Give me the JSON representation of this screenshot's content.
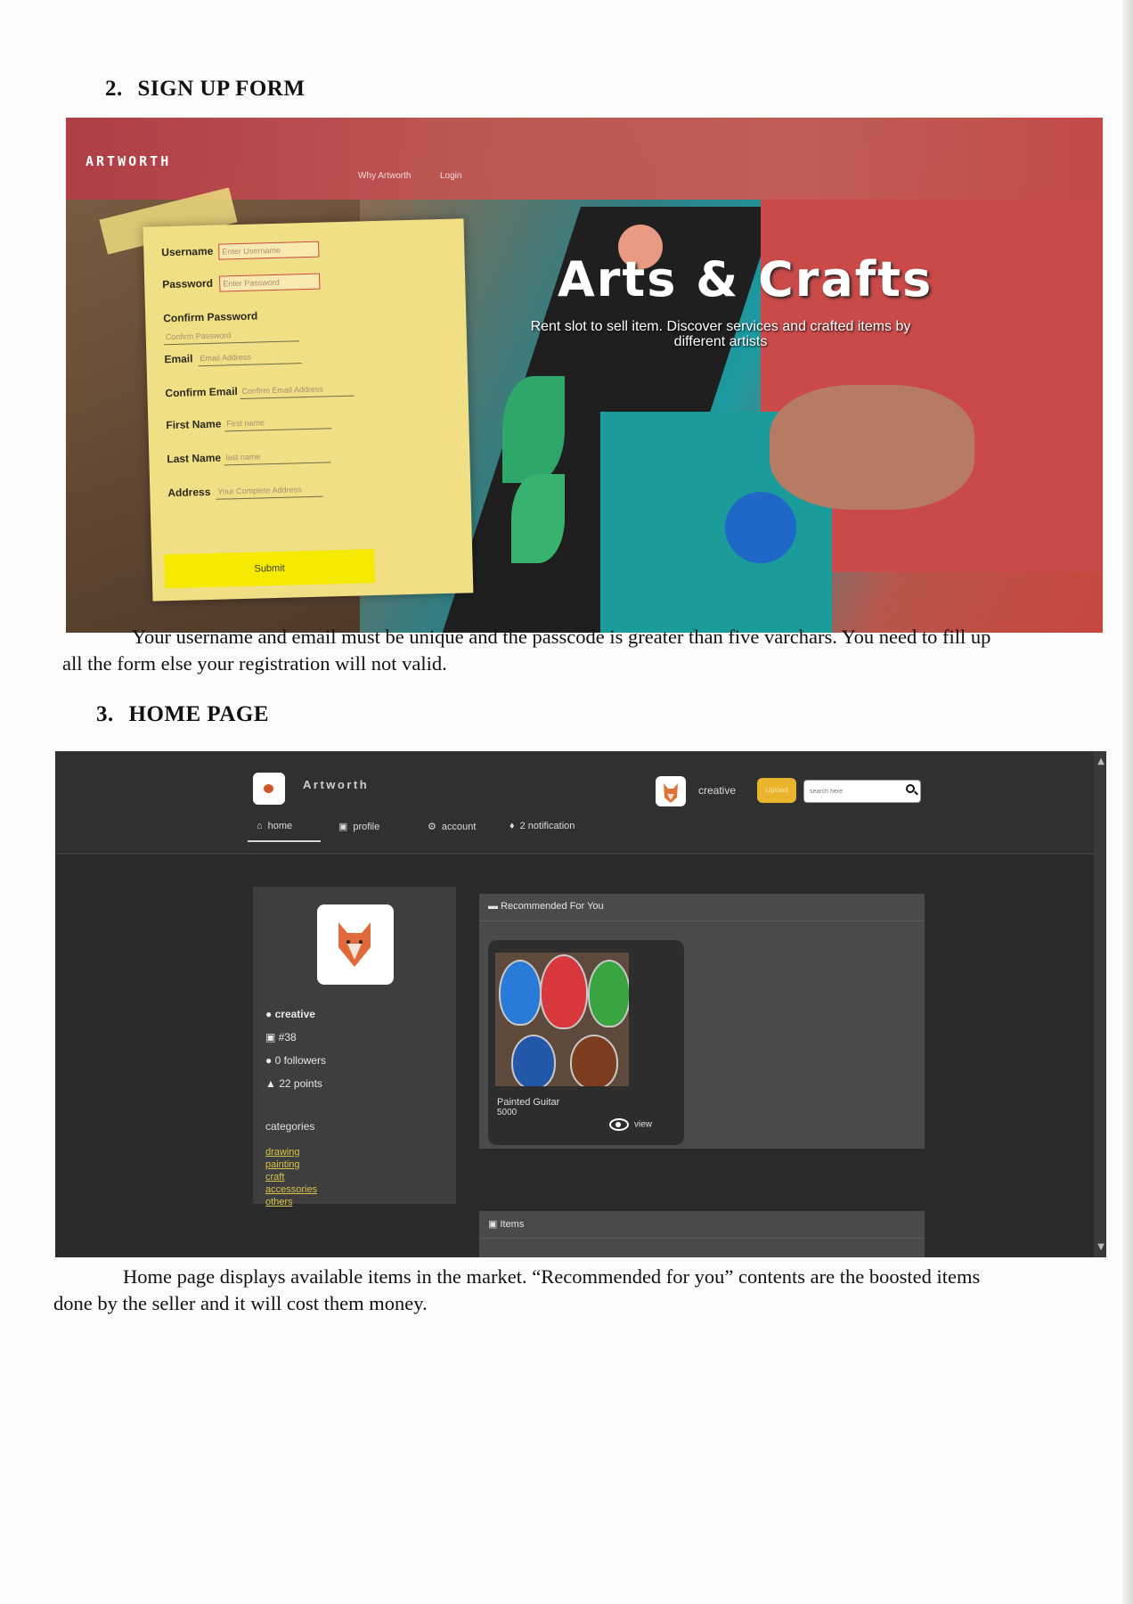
{
  "section2": {
    "number": "2.",
    "title": "SIGN UP FORM"
  },
  "signup": {
    "logo": "ARTWORTH",
    "nav": [
      "Why Artworth",
      "Login"
    ],
    "fields": [
      {
        "label": "Username",
        "placeholder": "Enter Username"
      },
      {
        "label": "Password",
        "placeholder": "Enter Password"
      },
      {
        "label": "Confirm Password",
        "placeholder": "Confirm Password"
      },
      {
        "label": "Email",
        "placeholder": "Email Address"
      },
      {
        "label": "Confirm Email",
        "placeholder": "Confirm Email Address"
      },
      {
        "label": "First Name",
        "placeholder": "First name"
      },
      {
        "label": "Last Name",
        "placeholder": "last name"
      },
      {
        "label": "Address",
        "placeholder": "Your Complete Address"
      }
    ],
    "submit_label": "Submit",
    "hero_title": "Arts & Crafts",
    "hero_subtitle": "Rent slot to sell item. Discover services and crafted items by different artists"
  },
  "caption1": {
    "line1": "Your username and email must be unique and the passcode is greater than five varchars. You need to fill up",
    "line2": "all the form else your registration will not valid."
  },
  "section3": {
    "number": "3.",
    "title": "HOME PAGE"
  },
  "home": {
    "brand": "Artworth",
    "username": "creative",
    "yellow_button": "Upload",
    "search_placeholder": "search here",
    "tabs": [
      {
        "icon": "home-icon",
        "label": "home"
      },
      {
        "icon": "id-card-icon",
        "label": "profile"
      },
      {
        "icon": "gears-icon",
        "label": "account"
      },
      {
        "icon": "bell-icon",
        "label": "2 notification"
      }
    ],
    "profile": {
      "name": "creative",
      "rank": "#38",
      "followers": "0 followers",
      "points": "22 points"
    },
    "categories_title": "categories",
    "categories": [
      "drawing",
      "painting",
      "craft",
      "accessories",
      "others"
    ],
    "recommended_title": "Recommended For You",
    "items_title": "Items",
    "card": {
      "title": "Painted Guitar",
      "price": "5000",
      "view_label": "view"
    },
    "accent_color": "#e9b52c"
  },
  "caption2": {
    "line1": "Home page displays available items in the market. “Recommended for you” contents are the boosted items",
    "line2": "done by the seller and it will cost them money."
  }
}
